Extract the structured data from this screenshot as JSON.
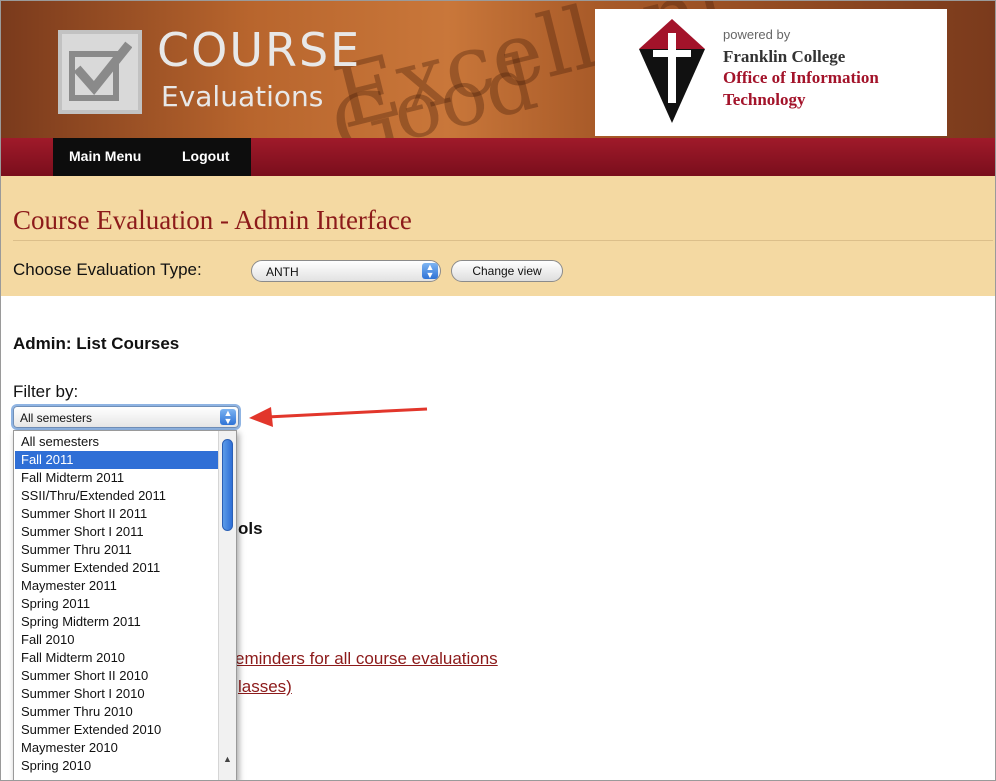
{
  "banner": {
    "course_word": "COURSE",
    "evaluations_word": "Evaluations",
    "watermark_1": "Excellent",
    "watermark_2": "Good",
    "powered_by": "powered by",
    "college_line_1": "Franklin College",
    "college_line_2": "Office of Information",
    "college_line_3": "Technology"
  },
  "nav": {
    "main_menu": "Main Menu",
    "logout": "Logout"
  },
  "header": {
    "title": "Course Evaluation - Admin Interface",
    "choose_label": "Choose Evaluation Type:",
    "type_value": "ANTH",
    "change_view": "Change view"
  },
  "main": {
    "list_title": "Admin: List Courses",
    "filter_label": "Filter by:",
    "filter_value": "All semesters",
    "tools_fragment": "ols",
    "reminders_fragment": "eminders for all course evaluations",
    "classes_fragment": "lasses)"
  },
  "dropdown": {
    "options": [
      "All semesters",
      "Fall 2011",
      "Fall Midterm 2011",
      "SSII/Thru/Extended 2011",
      "Summer Short II 2011",
      "Summer Short I 2011",
      "Summer Thru 2011",
      "Summer Extended 2011",
      "Maymester 2011",
      "Spring 2011",
      "Spring Midterm 2011",
      "Fall 2010",
      "Fall Midterm 2010",
      "Summer Short II 2010",
      "Summer Short I 2010",
      "Summer Thru 2010",
      "Summer Extended 2010",
      "Maymester 2010",
      "Spring 2010"
    ],
    "highlighted_option": "Fall 2011"
  },
  "colors": {
    "maroon": "#8c1a1a",
    "tan": "#f4d9a2",
    "nav_red": "#a01a2a",
    "selection_blue": "#2f6fd6"
  },
  "icons": {
    "logo": "checkbox-icon",
    "college_logo": "franklin-shield-icon",
    "annotation": "red-arrow-icon"
  }
}
